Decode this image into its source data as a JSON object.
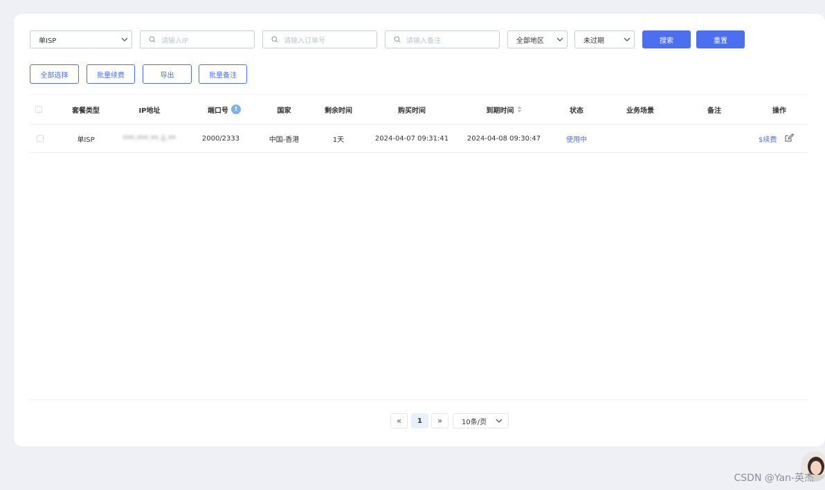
{
  "filters": {
    "type_select": "单ISP",
    "ip_placeholder": "请输入IP",
    "order_placeholder": "请输入订单号",
    "remark_placeholder": "请输入备注",
    "region_select": "全部地区",
    "expiry_select": "未过期",
    "search_label": "搜索",
    "reset_label": "重置"
  },
  "actions": {
    "select_all": "全部选择",
    "batch_renew": "批量续费",
    "export": "导出",
    "batch_remark": "批量备注"
  },
  "table": {
    "headers": {
      "package_type": "套餐类型",
      "ip": "IP地址",
      "port": "端口号",
      "country": "国家",
      "remaining": "剩余时间",
      "purchase_time": "购买时间",
      "expire_time": "到期时间",
      "status": "状态",
      "scenario": "业务场景",
      "remark": "备注",
      "operation": "操作"
    },
    "rows": [
      {
        "package_type": "单ISP",
        "ip": "***.***.**.1.**",
        "port": "2000/2333",
        "country": "中国-香港",
        "remaining": "1天",
        "purchase_time": "2024-04-07 09:31:41",
        "expire_time": "2024-04-08 09:30:47",
        "status": "使用中",
        "scenario": "",
        "remark": "",
        "renew_label": "$续费"
      }
    ]
  },
  "pagination": {
    "prev": "«",
    "current": "1",
    "next": "»",
    "page_size": "10条/页"
  },
  "watermark": "CSDN @Yan-英杰",
  "colors": {
    "primary": "#4e6ef2",
    "background": "#eef0f5",
    "info": "#7fb2e5"
  }
}
